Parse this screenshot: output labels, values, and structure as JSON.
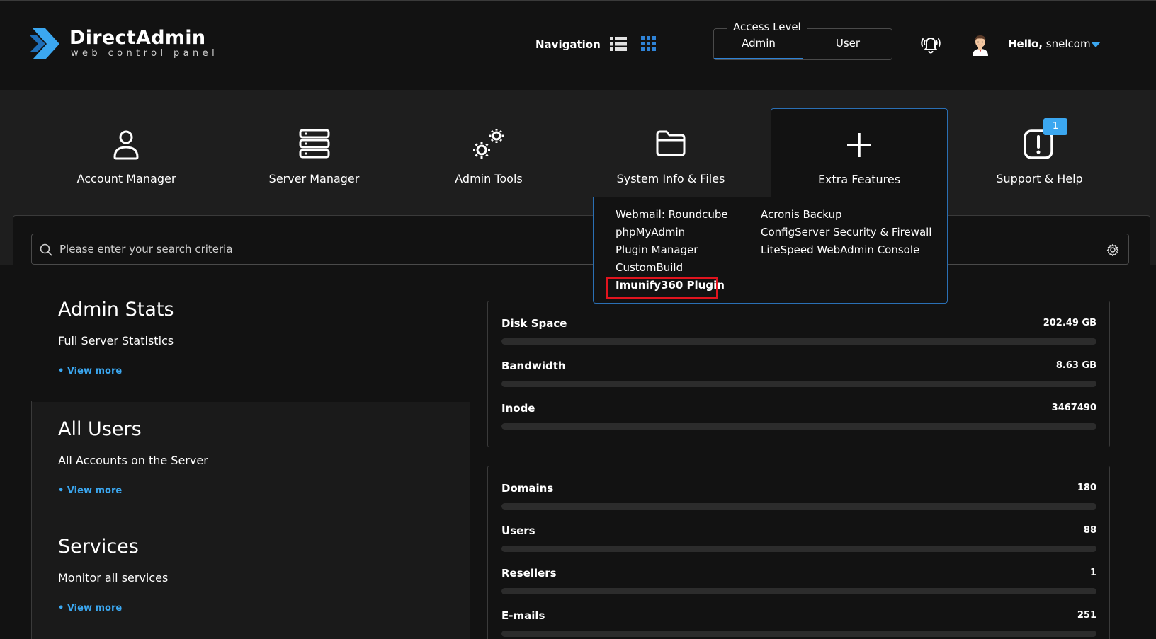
{
  "brand": {
    "name": "DirectAdmin",
    "tagline": "web control panel",
    "accent": "#3ba7f0"
  },
  "header": {
    "navigation_label": "Navigation",
    "access_level": {
      "title": "Access Level",
      "options": [
        "Admin",
        "User"
      ],
      "selected": "Admin"
    },
    "greeting": "Hello,",
    "username": "snelcom"
  },
  "menu": {
    "items": [
      {
        "label": "Account Manager",
        "icon": "user-icon"
      },
      {
        "label": "Server Manager",
        "icon": "server-icon"
      },
      {
        "label": "Admin Tools",
        "icon": "gears-icon"
      },
      {
        "label": "System Info & Files",
        "icon": "folder-icon"
      },
      {
        "label": "Extra Features",
        "icon": "plus-icon"
      },
      {
        "label": "Support & Help",
        "icon": "alert-icon",
        "badge": "1"
      }
    ],
    "extra_features_dropdown": {
      "column1": [
        "Webmail: Roundcube",
        "phpMyAdmin",
        "Plugin Manager",
        "CustomBuild",
        "Imunify360 Plugin"
      ],
      "column2": [
        "Acronis Backup",
        "ConfigServer Security & Firewall",
        "LiteSpeed WebAdmin Console"
      ],
      "highlighted": "Imunify360 Plugin",
      "highlight_color": "#e0141e"
    }
  },
  "search": {
    "placeholder": "Please enter your search criteria"
  },
  "cards": [
    {
      "title": "Admin Stats",
      "subtitle": "Full Server Statistics",
      "link": "View more"
    },
    {
      "title": "All Users",
      "subtitle": "All Accounts on the Server",
      "link": "View more"
    },
    {
      "title": "Services",
      "subtitle": "Monitor all services",
      "link": "View more"
    }
  ],
  "usage": [
    {
      "label": "Disk Space",
      "value": "202.49 GB"
    },
    {
      "label": "Bandwidth",
      "value": "8.63 GB"
    },
    {
      "label": "Inode",
      "value": "3467490"
    }
  ],
  "counts": [
    {
      "label": "Domains",
      "value": "180"
    },
    {
      "label": "Users",
      "value": "88"
    },
    {
      "label": "Resellers",
      "value": "1"
    },
    {
      "label": "E-mails",
      "value": "251"
    }
  ]
}
